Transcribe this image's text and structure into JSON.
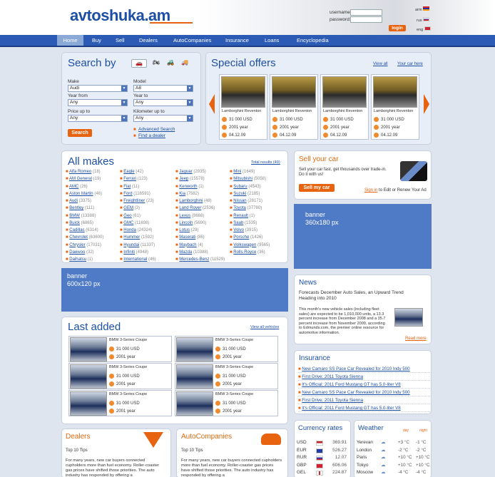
{
  "logo": {
    "text": "avtoshuka.am"
  },
  "login": {
    "username_label": "username:",
    "password_label": "password:",
    "button": "login",
    "langs": [
      "arm",
      "rus",
      "eng"
    ]
  },
  "nav": [
    "Home",
    "Buy",
    "Sell",
    "Dealers",
    "AutoCompanies",
    "Insurance",
    "Loans",
    "Encyclopedia"
  ],
  "search": {
    "title": "Search by",
    "make_label": "Make",
    "make_value": "Audi",
    "model_label": "Model",
    "model_value": "A8",
    "yearfrom_label": "Year from",
    "yearfrom_value": "Any",
    "yearto_label": "Year to",
    "yearto_value": "Any",
    "price_label": "Price up to",
    "price_value": "Any",
    "km_label": "Kilometer up to",
    "km_value": "Any",
    "button": "Search",
    "advanced": "Advanced Search",
    "dealer": "Find a dealer"
  },
  "offers": {
    "title": "Special offers",
    "view_all": "View all",
    "your_car": "Your car here",
    "items": [
      {
        "name": "Lamborghini Reventon",
        "price": "31 000 USD",
        "year": "2001 year",
        "date": "04.12.09"
      },
      {
        "name": "Lamborghini Reventon",
        "price": "31 000 USD",
        "year": "2001 year",
        "date": "04.12.09"
      },
      {
        "name": "Lamborghini Reventon",
        "price": "31 000 USD",
        "year": "2001 year",
        "date": "04.12.09"
      },
      {
        "name": "Lamborghini Reventon",
        "price": "31 000 USD",
        "year": "2001 year",
        "date": "04.12.09"
      }
    ]
  },
  "makes": {
    "title": "All makes",
    "total": "Total results (49)",
    "columns": [
      [
        [
          "Alfa Romeo",
          "(18)"
        ],
        [
          "AM General",
          "(19)"
        ],
        [
          "AMC",
          "(26)"
        ],
        [
          "Aston Martin",
          "(46)"
        ],
        [
          "Audi",
          "(3375)"
        ],
        [
          "Bentley",
          "(111)"
        ],
        [
          "BMW",
          "(13388)"
        ],
        [
          "Buick",
          "(6865)"
        ],
        [
          "Cadillac",
          "(6314)"
        ],
        [
          "Chevrolet",
          "(63600)"
        ],
        [
          "Chrysler",
          "(17031)"
        ],
        [
          "Daewoo",
          "(32)"
        ],
        [
          "Daihatsu",
          "(1)"
        ]
      ],
      [
        [
          "Eagle",
          "(42)"
        ],
        [
          "Ferrari",
          "(123)"
        ],
        [
          "Fiat",
          "(11)"
        ],
        [
          "Ford",
          "(116591)"
        ],
        [
          "Freightliner",
          "(23)"
        ],
        [
          "GEM",
          "(3)"
        ],
        [
          "Geo",
          "(61)"
        ],
        [
          "GMC",
          "(11698)"
        ],
        [
          "Honda",
          "(24324)"
        ],
        [
          "Hummer",
          "(1592)"
        ],
        [
          "Hyundai",
          "(11337)"
        ],
        [
          "Infiniti",
          "(4948)"
        ],
        [
          "International",
          "(46)"
        ]
      ],
      [
        [
          "Jaguar",
          "(2935)"
        ],
        [
          "Jeep",
          "(15578)"
        ],
        [
          "Kenworth",
          "(1)"
        ],
        [
          "Kia",
          "(7582)"
        ],
        [
          "Lamborghini",
          "(48)"
        ],
        [
          "Land Rover",
          "(2536)"
        ],
        [
          "Lexus",
          "(8668)"
        ],
        [
          "Lincoln",
          "(5690)"
        ],
        [
          "Lotus",
          "(29)"
        ],
        [
          "Maserati",
          "(86)"
        ],
        [
          "Maybach",
          "(4)"
        ],
        [
          "Mazda",
          "(10388)"
        ],
        [
          "Mercedes-Benz",
          "(11529)"
        ]
      ],
      [
        [
          "Mini",
          "(1649)"
        ],
        [
          "Mitsubishi",
          "(5058)"
        ],
        [
          "Subaru",
          "(4543)"
        ],
        [
          "Suzuki",
          "(2185)"
        ],
        [
          "Nissan",
          "(28171)"
        ],
        [
          "Toyota",
          "(37780)"
        ],
        [
          "Renault",
          "(1)"
        ],
        [
          "Saab",
          "(1535)"
        ],
        [
          "Volvo",
          "(3915)"
        ],
        [
          "Porsche",
          "(1426)"
        ],
        [
          "Volkswagen",
          "(9565)"
        ],
        [
          "Rolls Royce",
          "(36)"
        ]
      ]
    ]
  },
  "sell": {
    "title": "Sell your car",
    "text": "Sell your car fast, get thousands over trade-in. Do it with us!",
    "button": "Sell my car",
    "signin": "Sign in",
    "signin_rest": "to Edit or Renew Your Ad"
  },
  "banner_side": {
    "line1": "banner",
    "line2": "360x180 px"
  },
  "banner_main": {
    "line1": "banner",
    "line2": "600x120 px"
  },
  "news": {
    "title": "News",
    "headline": "Forecasts December Auto Sales, an Upward Trend Heading into 2010",
    "body": "This month's new vehicle sales (including fleet sales) are expected to be 1,010,000 units, a 13.3 percent increase from December 2008 and a 35.7 percent increase from November 2009, according to Edmunds.com, the premier online resource for automotive information.",
    "more": "Read more"
  },
  "last_added": {
    "title": "Last added",
    "view_all": "View all vehicles",
    "items": [
      {
        "name": "BMW 3-Series Coupe",
        "price": "31 000 USD",
        "year": "2001 year"
      },
      {
        "name": "BMW 3-Series Coupe",
        "price": "31 000 USD",
        "year": "2001 year"
      },
      {
        "name": "BMW 3-Series Coupe",
        "price": "31 000 USD",
        "year": "2001 year"
      },
      {
        "name": "BMW 3-Series Coupe",
        "price": "31 000 USD",
        "year": "2001 year"
      },
      {
        "name": "BMW 3-Series Coupe",
        "price": "31 000 USD",
        "year": "2001 year"
      },
      {
        "name": "BMW 3-Series Coupe",
        "price": "31 000 USD",
        "year": "2001 year"
      }
    ]
  },
  "insurance": {
    "title": "Insurance",
    "items": [
      "New Camaro SS Pace Car Revealed for 2010 Indy 500",
      "First Drive: 2011 Toyota Sienna",
      "It's Official: 2011 Ford Mustang GT has 5.0-liter V8",
      "New Camaro SS Pace Car Revealed for 2010 Indy 500",
      "First Drive: 2011 Toyota Sienna",
      "It's Official: 2011 Ford Mustang GT has 5.0-liter V8"
    ]
  },
  "dealers": {
    "title": "Dealers",
    "subtitle": "Top 10 Tips",
    "text": "For many years, new car buyers connected cupholders more than fuel economy. Roller-coaster gas prices have shifted those priorities. The auto industry has responded by offering a"
  },
  "autocompanies": {
    "title": "AutoCompanies",
    "subtitle": "Top 10 Tips",
    "text": "For many years, new car buyers connected cupholders more than fuel economy. Roller-coaster gas prices have shifted those priorities. The auto industry has responded by offering a"
  },
  "currency": {
    "title": "Currency rates",
    "rows": [
      [
        "USD",
        "369.91"
      ],
      [
        "EUR",
        "526.27"
      ],
      [
        "RUR",
        "12.07"
      ],
      [
        "GBP",
        "606.06"
      ],
      [
        "GEL",
        "224.87"
      ]
    ]
  },
  "weather": {
    "title": "Weather",
    "day": "day",
    "night": "night",
    "rows": [
      [
        "Yerevan",
        "+3 °C",
        "-1 °C"
      ],
      [
        "London",
        "-2 °C",
        "-2 °C"
      ],
      [
        "Paris",
        "+10 °C",
        "+10 °C"
      ],
      [
        "Tokyo",
        "+10 °C",
        "+10 °C"
      ],
      [
        "Moscow",
        "-4 °C",
        "-4 °C"
      ]
    ]
  },
  "colors": {
    "nav": "#2b5bb5",
    "accent": "#e8630f",
    "link": "#1c4ea2",
    "banner": "#4f7ac5"
  }
}
